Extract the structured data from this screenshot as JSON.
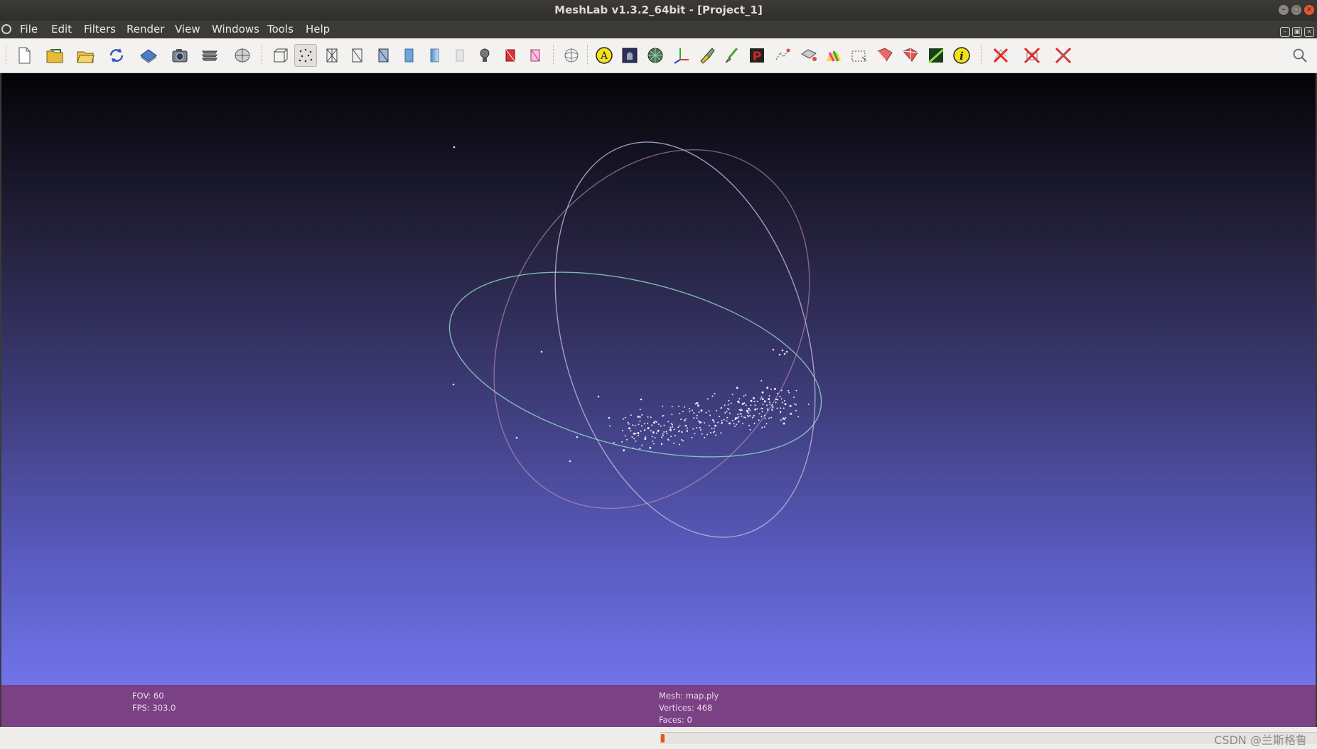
{
  "window": {
    "title": "MeshLab v1.3.2_64bit - [Project_1]"
  },
  "menu": {
    "items": [
      {
        "label": "File"
      },
      {
        "label": "Edit"
      },
      {
        "label": "Filters"
      },
      {
        "label": "Render"
      },
      {
        "label": "View"
      },
      {
        "label": "Windows"
      },
      {
        "label": "Tools"
      },
      {
        "label": "Help"
      }
    ]
  },
  "toolbar": {
    "icons": [
      "new-project-icon",
      "open-project-icon",
      "import-mesh-icon",
      "reload-icon",
      "export-mesh-icon",
      "snapshot-icon",
      "layers-icon",
      "raster-icon",
      "bbox-mode-icon",
      "points-mode-icon",
      "wireframe-mode-icon",
      "hidden-lines-mode-icon",
      "flat-lines-mode-icon",
      "flat-mode-icon",
      "smooth-mode-icon",
      "texture-mode-icon",
      "light-icon",
      "backface-icon",
      "double-side-icon",
      "trackball-icon",
      "annotation-icon",
      "mesh-info-icon",
      "sphere-texture-icon",
      "axis-icon",
      "paint-icon",
      "brush-icon",
      "pick-points-icon",
      "align-icon",
      "select-edit-icon",
      "color-paint-icon",
      "select-vertex-icon",
      "select-face-icon",
      "select-connected-icon",
      "quality-map-icon",
      "info-icon",
      "delete-selected-icon",
      "delete-faces-icon",
      "delete-vertices-icon"
    ]
  },
  "info": {
    "fov": "FOV: 60",
    "fps": "FPS:   303.0",
    "mesh": "Mesh: map.ply",
    "vertices": "Vertices: 468",
    "faces": "Faces: 0"
  },
  "progress": {
    "value": 0.005
  },
  "watermark": "CSDN @兰斯格鲁",
  "colors": {
    "accent": "#e95420",
    "infobar": "#7b4185",
    "viewport_top": "#040407",
    "viewport_bottom": "#7174ea"
  }
}
